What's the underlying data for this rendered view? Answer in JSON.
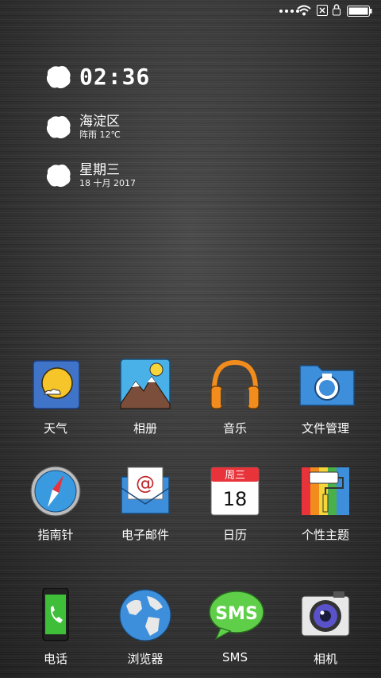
{
  "widget": {
    "time": "02:36",
    "location": "海淀区",
    "weather": "阵雨  12℃",
    "weekday": "星期三",
    "date": "18 十月 2017"
  },
  "apps": [
    {
      "label": "天气",
      "icon": "weather-icon"
    },
    {
      "label": "相册",
      "icon": "gallery-icon"
    },
    {
      "label": "音乐",
      "icon": "headphones-icon"
    },
    {
      "label": "文件管理",
      "icon": "folder-icon"
    },
    {
      "label": "指南针",
      "icon": "compass-icon"
    },
    {
      "label": "电子邮件",
      "icon": "email-icon"
    },
    {
      "label": "日历",
      "icon": "calendar-icon"
    },
    {
      "label": "个性主题",
      "icon": "theme-icon"
    }
  ],
  "dock": [
    {
      "label": "电话",
      "icon": "phone-icon"
    },
    {
      "label": "浏览器",
      "icon": "globe-icon"
    },
    {
      "label": "SMS",
      "icon": "sms-icon"
    },
    {
      "label": "相机",
      "icon": "camera-icon"
    }
  ],
  "calendar_icon": {
    "header": "周三",
    "day": "18"
  },
  "sms_icon_text": "SMS",
  "email_icon_text": "@",
  "colors": {
    "weather_bg": "#3f74c8",
    "sun": "#f5c52a",
    "headphones": "#f28c1c",
    "folder": "#3d8fdc",
    "calendar_red": "#e8333a",
    "phone_green": "#3fbe3a",
    "sms_green": "#5fcf4a"
  }
}
